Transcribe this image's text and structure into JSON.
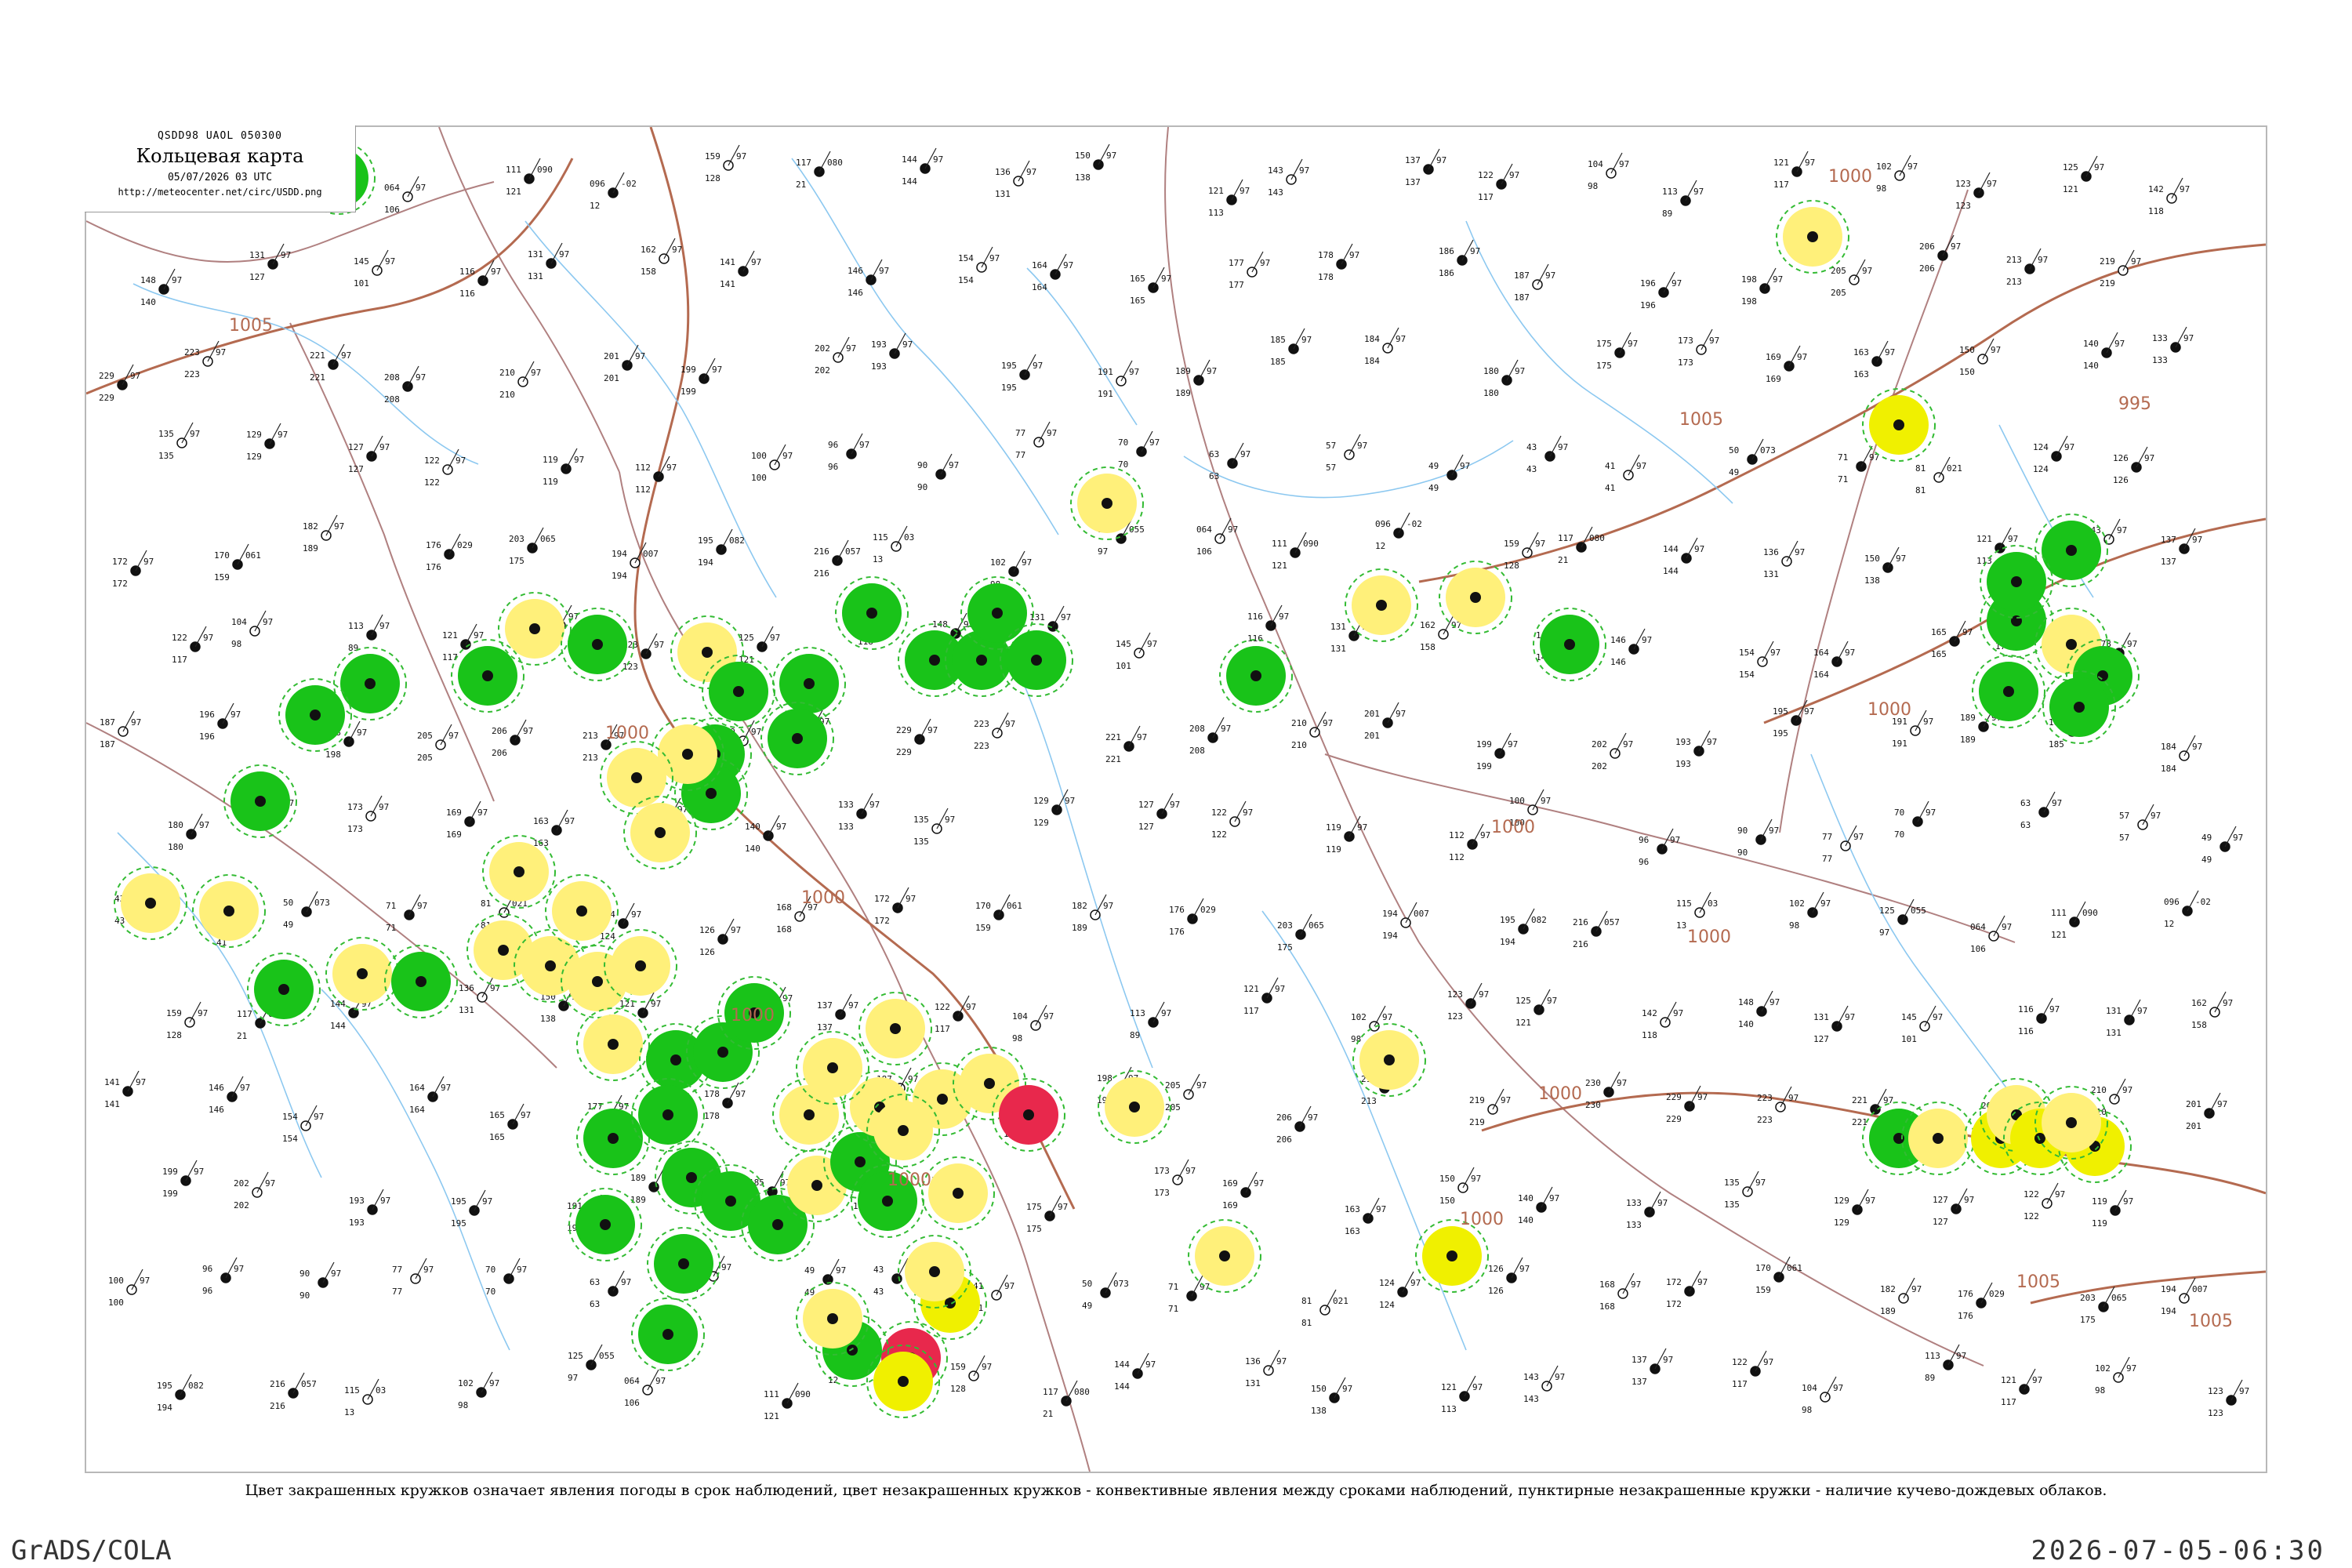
{
  "header": {
    "code": "QSDD98  UAOL  050300",
    "title": "Кольцевая карта",
    "datetime": "05/07/2026 03 UTC",
    "url": "http://meteocenter.net/circ/USDD.png"
  },
  "caption": "Цвет закрашенных кружков означает явления погоды в срок наблюдений, цвет незакрашенных кружков - конвективные явления между сроками наблюдений, пунктирные незакрашенные кружки - наличие кучево-дождевых облаков.",
  "footer": {
    "left": "GrADS/COLA",
    "right": "2026-07-05-06:30"
  },
  "colors": {
    "thunderstorm": "#19c319",
    "showers": "#fff07a",
    "heavy_rain": "#f0f000",
    "hail": "#e8284c",
    "isobar": "#b46a50",
    "river": "#8cc8f0",
    "border": "#b08080",
    "cb_cloud": "#33bb33"
  },
  "isobar_labels": [
    "1005",
    "1005",
    "1000",
    "1000",
    "1000",
    "1000",
    "1000",
    "1000",
    "995",
    "1005",
    "1000",
    "1005",
    "1000",
    "1005",
    "1000",
    "1000"
  ],
  "stations": [
    {
      "p": "115",
      "v": "03",
      "t": "13"
    },
    {
      "p": "102",
      "v": "97",
      "t": "98"
    },
    {
      "p": "125",
      "v": "055",
      "t": "97"
    },
    {
      "p": "064",
      "v": "97",
      "t": "106"
    },
    {
      "p": "111",
      "v": "090",
      "t": "121"
    },
    {
      "p": "096",
      "v": "-02",
      "t": "12"
    },
    {
      "p": "159",
      "v": "97",
      "t": "128"
    },
    {
      "p": "117",
      "v": "080",
      "t": "21"
    },
    {
      "p": "144",
      "v": "97",
      "t": "144"
    },
    {
      "p": "136",
      "v": "97",
      "t": "131"
    },
    {
      "p": "150",
      "v": "97",
      "t": "138"
    },
    {
      "p": "121",
      "v": "97",
      "t": "113"
    },
    {
      "p": "143",
      "v": "97",
      "t": "143"
    },
    {
      "p": "137",
      "v": "97",
      "t": "137"
    },
    {
      "p": "122",
      "v": "97",
      "t": "117"
    },
    {
      "p": "104",
      "v": "97",
      "t": "98"
    },
    {
      "p": "113",
      "v": "97",
      "t": "89"
    },
    {
      "p": "121",
      "v": "97",
      "t": "117"
    },
    {
      "p": "102",
      "v": "97",
      "t": "98"
    },
    {
      "p": "123",
      "v": "97",
      "t": "123"
    },
    {
      "p": "125",
      "v": "97",
      "t": "121"
    },
    {
      "p": "142",
      "v": "97",
      "t": "118"
    },
    {
      "p": "148",
      "v": "97",
      "t": "140"
    },
    {
      "p": "131",
      "v": "97",
      "t": "127"
    },
    {
      "p": "145",
      "v": "97",
      "t": "101"
    },
    {
      "p": "116",
      "v": "97",
      "t": "116"
    },
    {
      "p": "131",
      "v": "97",
      "t": "131"
    },
    {
      "p": "162",
      "v": "97",
      "t": "158"
    },
    {
      "p": "141",
      "v": "97",
      "t": "141"
    },
    {
      "p": "146",
      "v": "97",
      "t": "146"
    },
    {
      "p": "154",
      "v": "97",
      "t": "154"
    },
    {
      "p": "164",
      "v": "97",
      "t": "164"
    },
    {
      "p": "165",
      "v": "97",
      "t": "165"
    },
    {
      "p": "177",
      "v": "97",
      "t": "177"
    },
    {
      "p": "178",
      "v": "97",
      "t": "178"
    },
    {
      "p": "186",
      "v": "97",
      "t": "186"
    },
    {
      "p": "187",
      "v": "97",
      "t": "187"
    },
    {
      "p": "196",
      "v": "97",
      "t": "196"
    },
    {
      "p": "198",
      "v": "97",
      "t": "198"
    },
    {
      "p": "205",
      "v": "97",
      "t": "205"
    },
    {
      "p": "206",
      "v": "97",
      "t": "206"
    },
    {
      "p": "213",
      "v": "97",
      "t": "213"
    },
    {
      "p": "219",
      "v": "97",
      "t": "219"
    },
    {
      "p": "230",
      "v": "97",
      "t": "230"
    },
    {
      "p": "229",
      "v": "97",
      "t": "229"
    },
    {
      "p": "223",
      "v": "97",
      "t": "223"
    },
    {
      "p": "221",
      "v": "97",
      "t": "221"
    },
    {
      "p": "208",
      "v": "97",
      "t": "208"
    },
    {
      "p": "210",
      "v": "97",
      "t": "210"
    },
    {
      "p": "201",
      "v": "97",
      "t": "201"
    },
    {
      "p": "199",
      "v": "97",
      "t": "199"
    },
    {
      "p": "202",
      "v": "97",
      "t": "202"
    },
    {
      "p": "193",
      "v": "97",
      "t": "193"
    },
    {
      "p": "195",
      "v": "97",
      "t": "195"
    },
    {
      "p": "191",
      "v": "97",
      "t": "191"
    },
    {
      "p": "189",
      "v": "97",
      "t": "189"
    },
    {
      "p": "185",
      "v": "97",
      "t": "185"
    },
    {
      "p": "184",
      "v": "97",
      "t": "184"
    },
    {
      "p": "180",
      "v": "97",
      "t": "180"
    },
    {
      "p": "175",
      "v": "97",
      "t": "175"
    },
    {
      "p": "173",
      "v": "97",
      "t": "173"
    },
    {
      "p": "169",
      "v": "97",
      "t": "169"
    },
    {
      "p": "163",
      "v": "97",
      "t": "163"
    },
    {
      "p": "150",
      "v": "97",
      "t": "150"
    },
    {
      "p": "140",
      "v": "97",
      "t": "140"
    },
    {
      "p": "133",
      "v": "97",
      "t": "133"
    },
    {
      "p": "135",
      "v": "97",
      "t": "135"
    },
    {
      "p": "129",
      "v": "97",
      "t": "129"
    },
    {
      "p": "127",
      "v": "97",
      "t": "127"
    },
    {
      "p": "122",
      "v": "97",
      "t": "122"
    },
    {
      "p": "119",
      "v": "97",
      "t": "119"
    },
    {
      "p": "112",
      "v": "97",
      "t": "112"
    },
    {
      "p": "100",
      "v": "97",
      "t": "100"
    },
    {
      "p": "96",
      "v": "97",
      "t": "96"
    },
    {
      "p": "90",
      "v": "97",
      "t": "90"
    },
    {
      "p": "77",
      "v": "97",
      "t": "77"
    },
    {
      "p": "70",
      "v": "97",
      "t": "70"
    },
    {
      "p": "63",
      "v": "97",
      "t": "63"
    },
    {
      "p": "57",
      "v": "97",
      "t": "57"
    },
    {
      "p": "49",
      "v": "97",
      "t": "49"
    },
    {
      "p": "43",
      "v": "97",
      "t": "43"
    },
    {
      "p": "41",
      "v": "97",
      "t": "41"
    },
    {
      "p": "50",
      "v": "073",
      "t": "49"
    },
    {
      "p": "71",
      "v": "97",
      "t": "71"
    },
    {
      "p": "81",
      "v": "021",
      "t": "81"
    },
    {
      "p": "124",
      "v": "97",
      "t": "124"
    },
    {
      "p": "126",
      "v": "97",
      "t": "126"
    },
    {
      "p": "168",
      "v": "97",
      "t": "168"
    },
    {
      "p": "172",
      "v": "97",
      "t": "172"
    },
    {
      "p": "170",
      "v": "061",
      "t": "159"
    },
    {
      "p": "182",
      "v": "97",
      "t": "189"
    },
    {
      "p": "176",
      "v": "029",
      "t": "176"
    },
    {
      "p": "203",
      "v": "065",
      "t": "175"
    },
    {
      "p": "194",
      "v": "007",
      "t": "194"
    },
    {
      "p": "195",
      "v": "082",
      "t": "194"
    },
    {
      "p": "216",
      "v": "057",
      "t": "216"
    }
  ]
}
